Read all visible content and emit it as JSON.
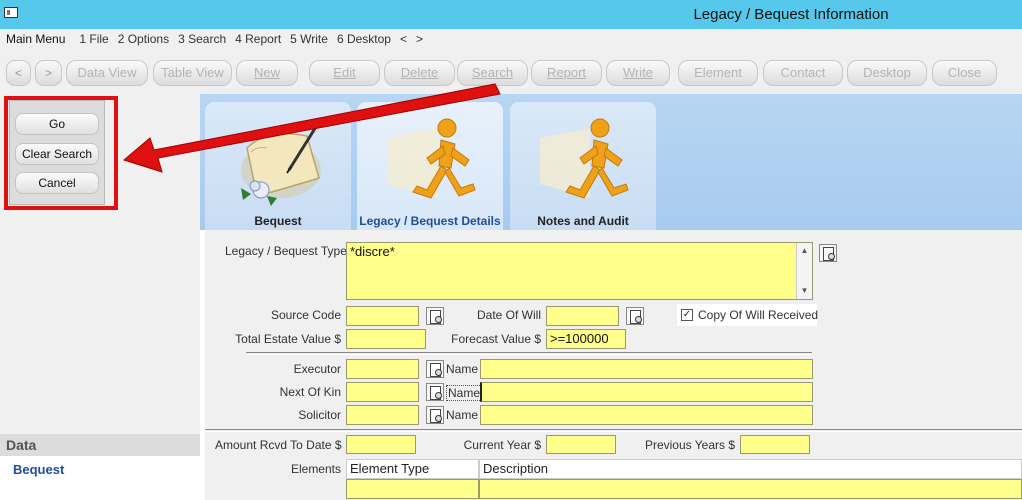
{
  "window": {
    "title": "Legacy / Bequest Information",
    "icon": "window-icon"
  },
  "menu": {
    "items": [
      "Main Menu",
      "1 File",
      "2 Options",
      "3 Search",
      "4 Report",
      "5 Write",
      "6 Desktop",
      "<",
      ">"
    ]
  },
  "toolbar": {
    "back": "<",
    "forward": ">",
    "buttons": [
      "Data View",
      "Table View",
      "New",
      "Edit",
      "Delete",
      "Search",
      "Report",
      "Write",
      "Element",
      "Contact",
      "Desktop",
      "Close"
    ]
  },
  "search_actions": {
    "go": "Go",
    "clear": "Clear Search",
    "cancel": "Cancel"
  },
  "sidebar": {
    "header": "Data",
    "items": [
      "Bequest"
    ]
  },
  "tabs": [
    {
      "label": "Bequest",
      "icon": "scroll-pen-icon"
    },
    {
      "label": "Legacy / Bequest Details",
      "icon": "running-man-icon",
      "active": true
    },
    {
      "label": "Notes and Audit",
      "icon": "running-man-icon"
    }
  ],
  "form": {
    "type_label": "Legacy / Bequest Type",
    "type_value": "*discre*",
    "source_code_label": "Source Code",
    "source_code_value": "",
    "date_of_will_label": "Date Of Will",
    "date_of_will_value": "",
    "copy_of_will_label": "Copy Of Will Received",
    "copy_of_will_checked": true,
    "total_estate_label": "Total Estate Value $",
    "total_estate_value": "",
    "forecast_label": "Forecast Value $",
    "forecast_value": ">=100000",
    "executor_label": "Executor",
    "next_of_kin_label": "Next Of Kin",
    "solicitor_label": "Solicitor",
    "name_label": "Name",
    "amount_rcvd_label": "Amount Rcvd To Date $",
    "current_year_label": "Current Year $",
    "previous_years_label": "Previous Years $",
    "elements_label": "Elements",
    "grid_headers": [
      "Element Type",
      "Description"
    ]
  },
  "colors": {
    "titlebar": "#56c8ec",
    "field": "#ffff8c",
    "highlight": "#e01010",
    "tab_active_text": "#1f4e9a"
  }
}
